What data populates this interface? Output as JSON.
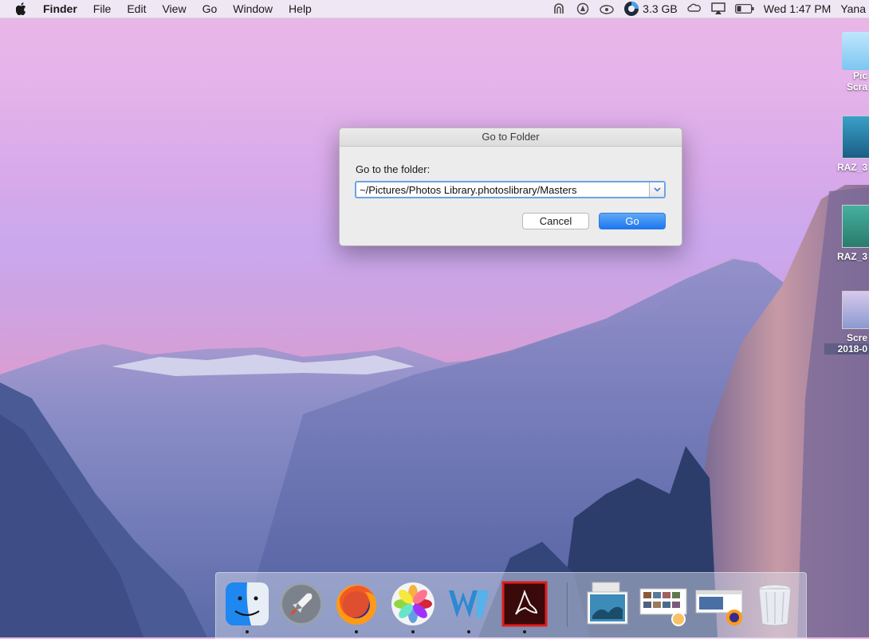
{
  "menubar": {
    "app_name": "Finder",
    "menus": [
      "File",
      "Edit",
      "View",
      "Go",
      "Window",
      "Help"
    ],
    "memory": "3.3 GB",
    "clock": "Wed 1:47 PM",
    "user": "Yana"
  },
  "desktop_icons": [
    {
      "label": "Pic",
      "label2": "Scra"
    },
    {
      "label": "RAZ_3"
    },
    {
      "label": "RAZ_3"
    },
    {
      "label": "Scre",
      "label2": "2018-0"
    }
  ],
  "dialog": {
    "title": "Go to Folder",
    "prompt": "Go to the folder:",
    "path_value": "~/Pictures/Photos Library.photoslibrary/Masters",
    "cancel_label": "Cancel",
    "go_label": "Go"
  },
  "dock": {
    "apps": [
      "finder",
      "launchpad",
      "firefox",
      "photos",
      "word",
      "acrobat",
      "preview",
      "photo-browser",
      "firefox-window",
      "trash"
    ]
  },
  "colors": {
    "accent": "#1d77f0",
    "focus_ring": "#6ea2e6"
  }
}
